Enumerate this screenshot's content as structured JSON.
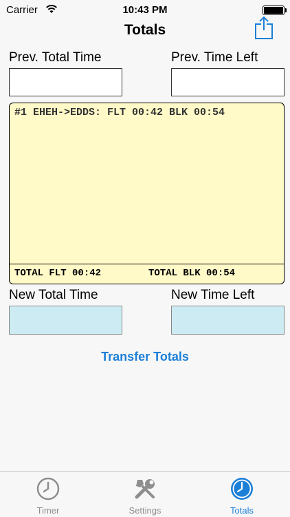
{
  "status_bar": {
    "carrier": "Carrier",
    "time": "10:43 PM"
  },
  "nav": {
    "title": "Totals",
    "share_icon": "share-icon"
  },
  "prev": {
    "total_time_label": "Prev. Total Time",
    "total_time_value": "",
    "time_left_label": "Prev. Time Left",
    "time_left_value": ""
  },
  "log": {
    "entries": [
      "#1 EHEH->EDDS: FLT 00:42 BLK 00:54"
    ],
    "total_flt": "TOTAL FLT 00:42",
    "total_blk": "TOTAL BLK 00:54"
  },
  "new": {
    "total_time_label": "New Total Time",
    "total_time_value": "",
    "time_left_label": "New Time Left",
    "time_left_value": ""
  },
  "actions": {
    "transfer_label": "Transfer Totals"
  },
  "tabs": [
    {
      "label": "Timer",
      "icon": "clock-icon",
      "active": false
    },
    {
      "label": "Settings",
      "icon": "tools-icon",
      "active": false
    },
    {
      "label": "Totals",
      "icon": "clock-icon",
      "active": true
    }
  ],
  "colors": {
    "accent": "#1c7fd8",
    "log_background": "#fffac8",
    "new_field_background": "#cdebf3",
    "inactive_tab": "#8e8e8e"
  }
}
